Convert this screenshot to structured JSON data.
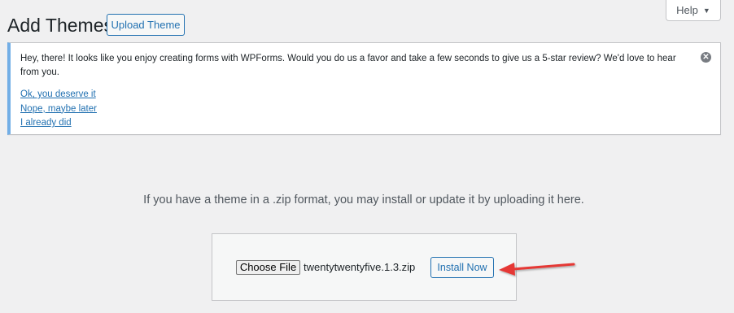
{
  "header": {
    "title": "Add Themes",
    "upload_button_label": "Upload Theme",
    "help_label": "Help",
    "help_caret": "▼"
  },
  "notice": {
    "message": "Hey, there! It looks like you enjoy creating forms with WPForms. Would you do us a favor and take a few seconds to give us a 5-star review? We'd love to hear from you.",
    "links": [
      "Ok, you deserve it",
      "Nope, maybe later",
      "I already did"
    ],
    "dismiss_icon": "✕",
    "accent_color": "#72aee6"
  },
  "upload": {
    "instructions": "If you have a theme in a .zip format, you may install or update it by uploading it here.",
    "choose_file_label": "Choose File",
    "file_name": "twentytwentyfive.1.3.zip",
    "install_button_label": "Install Now"
  },
  "annotation": {
    "arrow_color": "#e53935"
  },
  "colors": {
    "background": "#f0f0f1",
    "primary": "#2271b1"
  }
}
